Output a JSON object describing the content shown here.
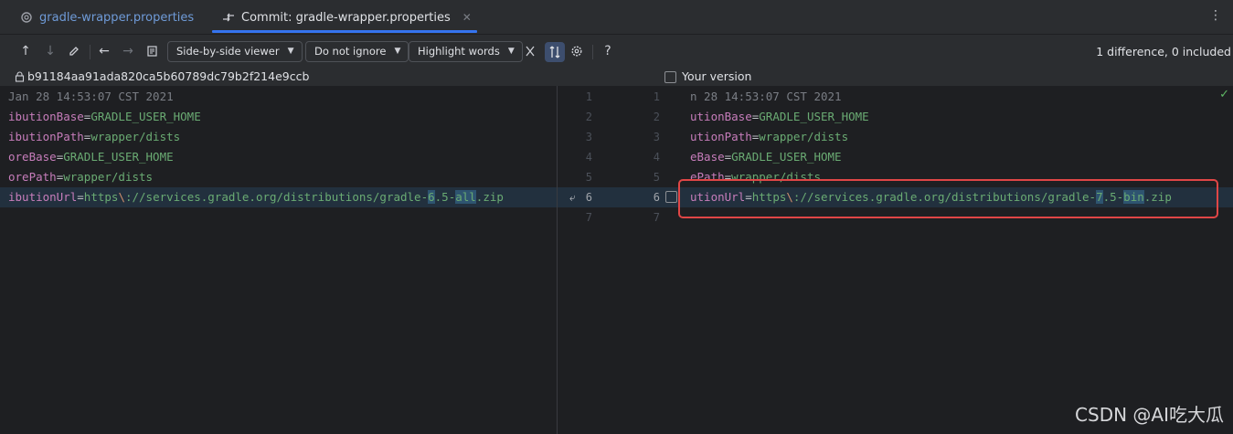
{
  "tabs": [
    {
      "label": "gradle-wrapper.properties",
      "icon": "gear-icon",
      "active": false
    },
    {
      "label": "Commit: gradle-wrapper.properties",
      "icon": "commit-compare-icon",
      "active": true
    }
  ],
  "toolbar": {
    "viewer_label": "Side-by-side viewer",
    "ignore_label": "Do not ignore",
    "highlight_label": "Highlight words",
    "status": "1 difference, 0 included"
  },
  "files": {
    "left_revision": "b91184aa91ada820ca5b60789dc79b2f214e9ccb",
    "right_label": "Your version"
  },
  "left_lines": [
    {
      "n": "1",
      "text": "Jan 28 14:53:07 CST 2021"
    },
    {
      "n": "2",
      "key": "ibutionBase",
      "eq": "=",
      "val": "GRADLE_USER_HOME"
    },
    {
      "n": "3",
      "key": "ibutionPath",
      "eq": "=",
      "val": "wrapper/dists"
    },
    {
      "n": "4",
      "key": "oreBase",
      "eq": "=",
      "val": "GRADLE_USER_HOME"
    },
    {
      "n": "5",
      "key": "orePath",
      "eq": "=",
      "val": "wrapper/dists"
    },
    {
      "n": "6",
      "key": "ibutionUrl",
      "eq": "=",
      "pre": "https",
      "esc": "\\",
      "mid": "://services.gradle.org/distributions/gradle-",
      "d1": "6",
      "sep": ".5-",
      "d2": "all",
      "post": ".zip"
    },
    {
      "n": "7",
      "text": ""
    }
  ],
  "right_lines": [
    {
      "n": "1",
      "text": "n 28 14:53:07 CST 2021"
    },
    {
      "n": "2",
      "key": "utionBase",
      "eq": "=",
      "val": "GRADLE_USER_HOME"
    },
    {
      "n": "3",
      "key": "utionPath",
      "eq": "=",
      "val": "wrapper/dists"
    },
    {
      "n": "4",
      "key": "eBase",
      "eq": "=",
      "val": "GRADLE_USER_HOME"
    },
    {
      "n": "5",
      "key": "ePath",
      "eq": "=",
      "val": "wrapper/dists"
    },
    {
      "n": "6",
      "key": "utionUrl",
      "eq": "=",
      "pre": "https",
      "esc": "\\",
      "mid": "://services.gradle.org/distributions/gradle-",
      "d1": "7",
      "sep": ".5-",
      "d2": "bin",
      "post": ".zip"
    },
    {
      "n": "7",
      "text": ""
    }
  ],
  "watermark": "CSDN @AI吃大瓜",
  "colors": {
    "accent": "#3574f0",
    "highlight_box": "#e04646"
  }
}
